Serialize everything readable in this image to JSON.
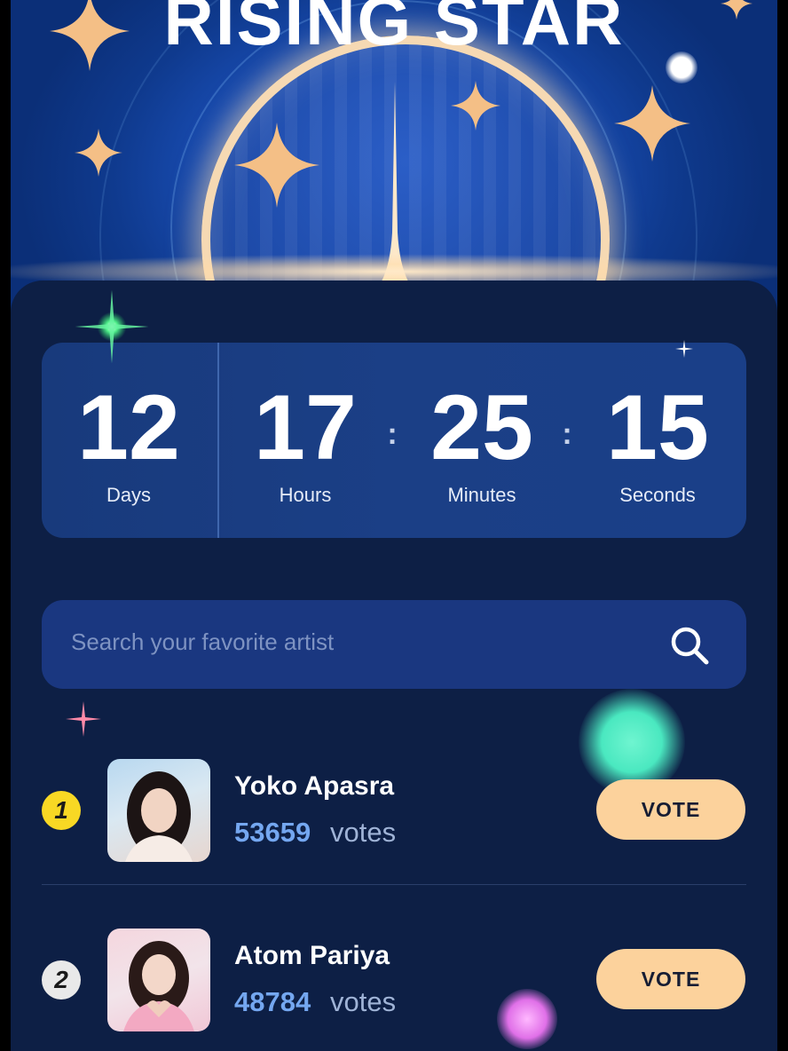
{
  "banner": {
    "title": "RISING STAR"
  },
  "countdown": {
    "days": {
      "value": "12",
      "label": "Days"
    },
    "hours": {
      "value": "17",
      "label": "Hours"
    },
    "minutes": {
      "value": "25",
      "label": "Minutes"
    },
    "seconds": {
      "value": "15",
      "label": "Seconds"
    },
    "separator": ":"
  },
  "search": {
    "placeholder": "Search your favorite artist",
    "icon": "search-icon"
  },
  "artists": [
    {
      "rank": "1",
      "name": "Yoko Apasra",
      "votes": "53659",
      "votes_label": "votes",
      "button": "VOTE",
      "rank_color": "#f8d824"
    },
    {
      "rank": "2",
      "name": "Atom Pariya",
      "votes": "48784",
      "votes_label": "votes",
      "button": "VOTE",
      "rank_color": "#e9e9e9"
    }
  ],
  "colors": {
    "accent": "#fcd29c",
    "background": "#0d1f45",
    "votes": "#74a7f0"
  }
}
